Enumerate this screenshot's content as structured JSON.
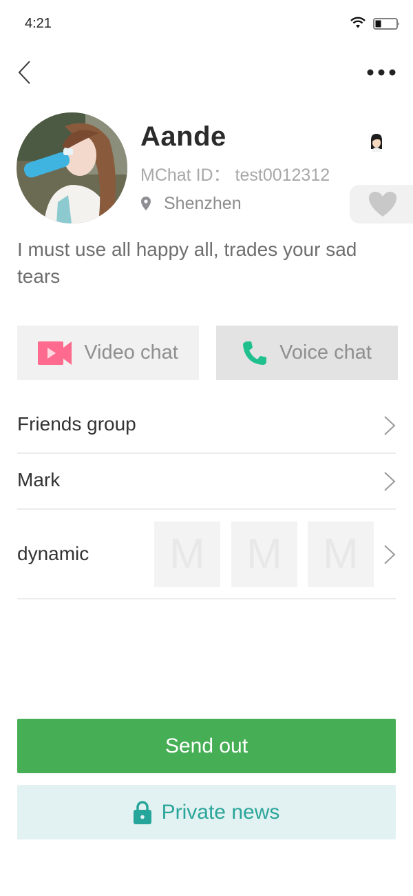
{
  "status_bar": {
    "time": "4:21",
    "icons": [
      "wifi-icon",
      "battery-icon"
    ]
  },
  "nav": {
    "back_icon": "chevron-left-icon",
    "more_icon": "more-horizontal-icon"
  },
  "profile": {
    "name": "Aande",
    "mchat_id": "MChat ID： test0012312",
    "location": "Shenzhen",
    "gender_icon": "female-avatar-icon",
    "like_icon": "heart-icon",
    "signature": "I must use all happy all, trades your sad  tears"
  },
  "actions": {
    "video_chat": "Video chat",
    "voice_chat": "Voice chat"
  },
  "colors": {
    "video_icon": "#ff6b8e",
    "voice_icon": "#1fc08e",
    "send_button": "#46ae55",
    "private_button_bg": "#e2f1f1",
    "private_button_text": "#2aa59a",
    "like_heart": "#c8c8c8"
  },
  "list": {
    "friends_group": "Friends group",
    "mark": "Mark",
    "dynamic": "dynamic",
    "dynamic_thumbs": [
      "M",
      "M",
      "M"
    ]
  },
  "buttons": {
    "send_out": "Send out",
    "private_news": "Private news"
  }
}
